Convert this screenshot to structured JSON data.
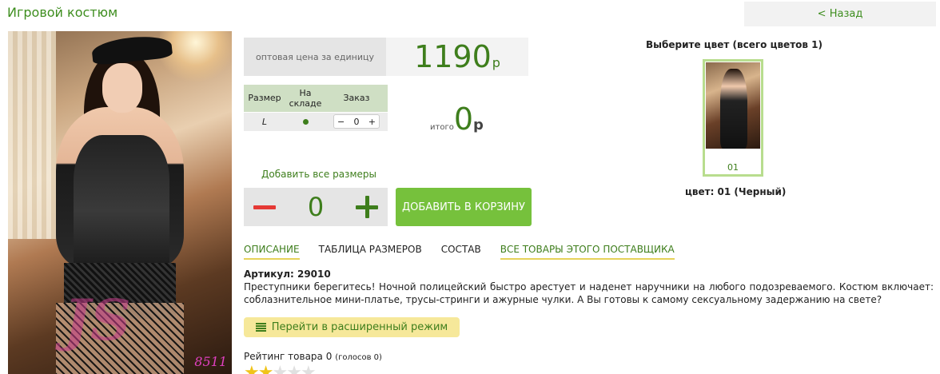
{
  "page": {
    "title": "Игровой костюм",
    "back_label": "< Назад"
  },
  "photo": {
    "watermark": "JS",
    "code": "8511"
  },
  "price": {
    "label": "оптовая цена за единицу",
    "value": "1190",
    "currency": "р"
  },
  "size_table": {
    "headers": [
      "Размер",
      "На складе",
      "Заказ"
    ],
    "rows": [
      {
        "size": "L",
        "order_qty": "0"
      }
    ]
  },
  "total": {
    "label": "итого",
    "value": "0",
    "currency": "р"
  },
  "add_all": {
    "label": "Добавить все размеры",
    "qty": "0"
  },
  "cart_button": "ДОБАВИТЬ В КОРЗИНУ",
  "color_picker": {
    "title": "Выберите цвет (всего цветов 1)",
    "swatch_label": "01",
    "selected": "цвет: 01 (Черный)"
  },
  "tabs": [
    "ОПИСАНИЕ",
    "ТАБЛИЦА РАЗМЕРОВ",
    "СОСТАВ",
    "ВСЕ ТОВАРЫ ЭТОГО ПОСТАВЩИКА"
  ],
  "article": "Артикул: 29010",
  "description": "Преступники берегитесь! Ночной полицейский быстро арестует и наденет наручники на любого подозреваемого. Костюм включает: соблазнительное мини-платье, трусы-стринги и ажурные чулки. А Вы готовы к самому сексуальному задержанию на свете?",
  "advanced_button": "Перейти в расширенный режим",
  "rating": {
    "label": "Рейтинг товара 0",
    "votes": "(голосов 0)",
    "stars": 2,
    "max": 5
  },
  "colors": {
    "accent": "#3e7e1c",
    "cart": "#76c13c",
    "minus": "#e53935",
    "highlight": "#f6e89a"
  }
}
